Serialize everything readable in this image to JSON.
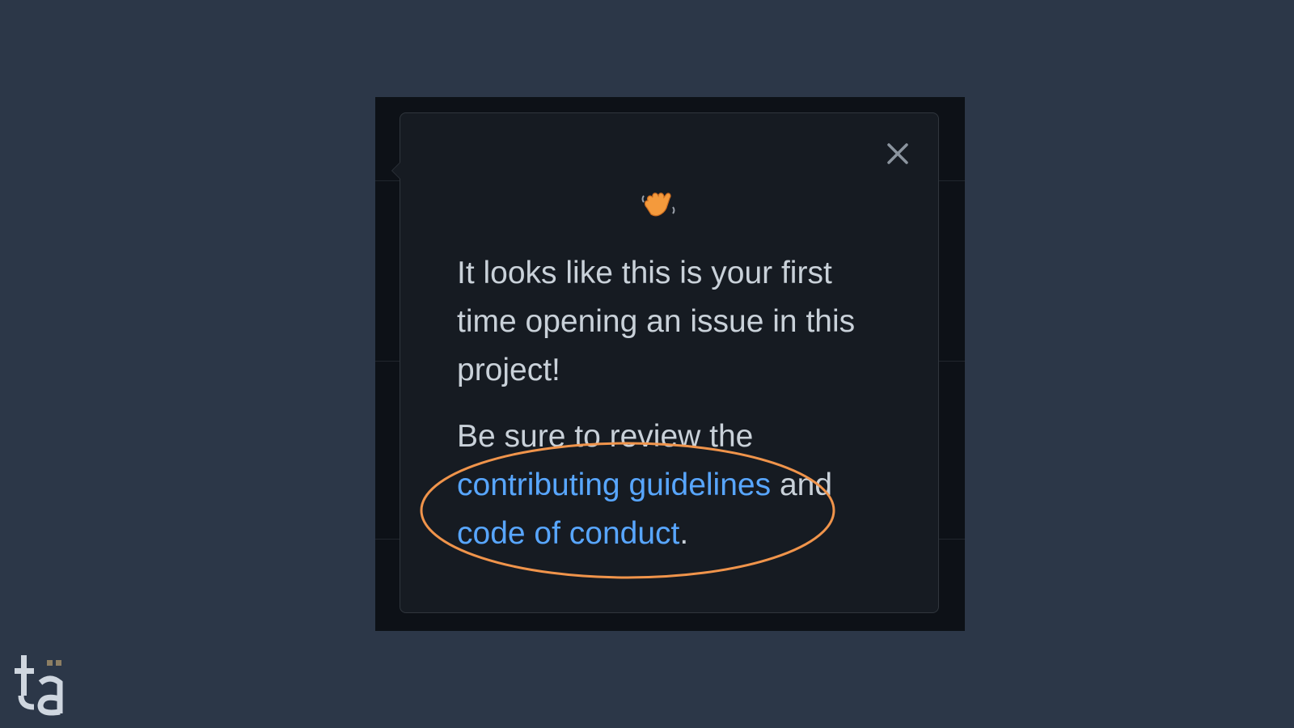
{
  "popover": {
    "intro_text": "It looks like this is your first time opening an issue in this project!",
    "review_prefix": "Be sure to review the",
    "guidelines_link": "contributing guidelines",
    "conjunction": " and ",
    "conduct_link": "code of conduct",
    "terminator": ".",
    "close_icon": "close-icon",
    "emoji_icon": "waving-hand-icon"
  },
  "annotation": {
    "highlight_color": "#f0944b"
  },
  "colors": {
    "page_background": "#2c3748",
    "popover_background": "#161b22",
    "text": "#c9d1d9",
    "link": "#58a6ff"
  }
}
